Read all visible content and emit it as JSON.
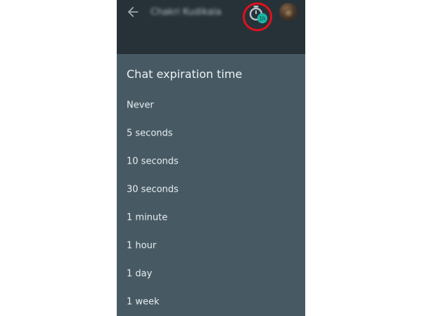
{
  "appbar": {
    "contact_name": "Chakri Kudikala",
    "back_icon": "arrow-back-icon",
    "timer_icon": "timer-icon",
    "timer_badge": "1h",
    "annotation_color": "#e3101e"
  },
  "dialog": {
    "title": "Chat expiration time",
    "options": [
      {
        "label": "Never"
      },
      {
        "label": "5 seconds"
      },
      {
        "label": "10 seconds"
      },
      {
        "label": "30 seconds"
      },
      {
        "label": "1 minute"
      },
      {
        "label": "1 hour"
      },
      {
        "label": "1 day"
      },
      {
        "label": "1 week"
      }
    ]
  },
  "colors": {
    "appbar": "#263238",
    "dialog": "#475a64",
    "badge": "#1bb5a6",
    "text": "#e8edf0"
  }
}
